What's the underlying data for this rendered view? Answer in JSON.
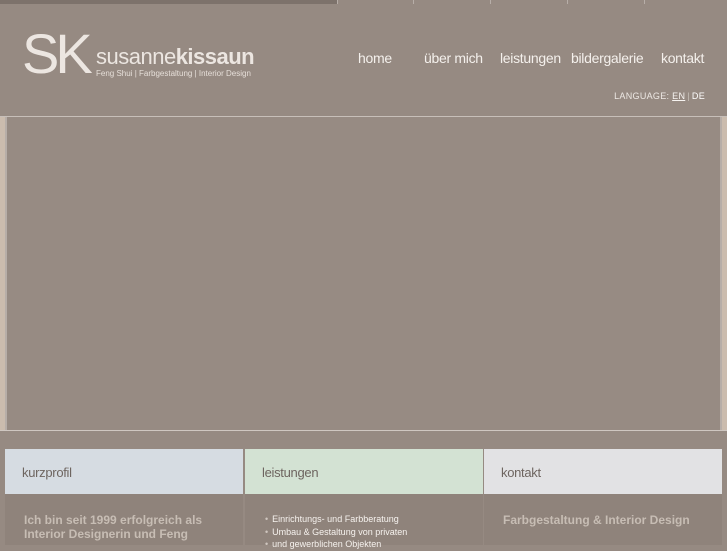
{
  "brand": {
    "mark": "SK",
    "name_light": "susanne",
    "name_bold": "kissaun",
    "tagline": "Feng Shui | Farbgestaltung | Interior Design"
  },
  "nav": {
    "items": [
      {
        "label": "home"
      },
      {
        "label": "über mich"
      },
      {
        "label": "leistungen"
      },
      {
        "label": "bildergalerie"
      },
      {
        "label": "kontakt"
      }
    ]
  },
  "language": {
    "label": "LANGUAGE:",
    "en": "EN",
    "separator": "|",
    "de": "DE"
  },
  "boxes": {
    "kurzprofil": {
      "title": "kurzprofil",
      "text": "Ich bin seit 1999 erfolgreich als Interior Designerin und Feng"
    },
    "leistungen": {
      "title": "leistungen",
      "items": [
        "Einrichtungs- und Farbberatung",
        "Umbau & Gestaltung von privaten",
        "und gewerblichen Objekten"
      ]
    },
    "kontakt": {
      "title": "kontakt",
      "text": "Farbgestaltung & Interior Design"
    }
  },
  "colors": {
    "background": "#968a82",
    "kurzprofil_header": "#d6dce2",
    "leistungen_header": "#d3e2d3",
    "kontakt_header": "#e2e2e4"
  }
}
